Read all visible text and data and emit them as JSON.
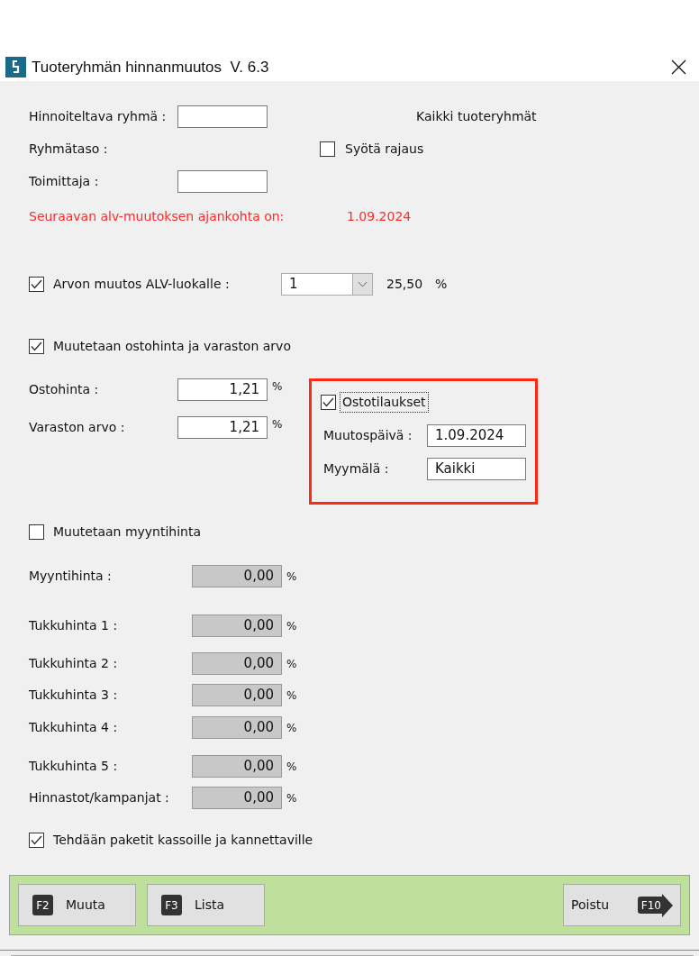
{
  "window": {
    "title": "Tuoteryhmän hinnanmuutos  V. 6.3"
  },
  "group_field": {
    "label": "Hinnoiteltava ryhmä :"
  },
  "group_summary": "Kaikki tuoteryhmät",
  "group_level": {
    "label": "Ryhmätaso :"
  },
  "limit_checkbox": {
    "label": "Syötä rajaus",
    "checked": false
  },
  "supplier_field": {
    "label": "Toimittaja :"
  },
  "vat_notice": {
    "text": "Seuraavan alv-muutoksen ajankohta on:",
    "date": "1.09.2024"
  },
  "vat_change": {
    "label": "Arvon muutos ALV-luokalle :",
    "checked": true,
    "class_value": "1",
    "rate": "25,50",
    "unit": "%"
  },
  "purchase": {
    "label": "Muutetaan ostohinta ja varaston arvo",
    "checked": true,
    "rows": [
      {
        "label": "Ostohinta :",
        "value": "1,21",
        "unit": "%",
        "disabled": false
      },
      {
        "label": "Varaston arvo :",
        "value": "1,21",
        "unit": "%",
        "disabled": false
      }
    ]
  },
  "orders": {
    "label": "Ostotilaukset",
    "checked": true,
    "focused": true,
    "fields": [
      {
        "label": "Muutospäivä :",
        "value": "1.09.2024"
      },
      {
        "label": "Myymälä :",
        "value": "Kaikki"
      }
    ]
  },
  "sales": {
    "label": "Muutetaan myyntihinta",
    "checked": false,
    "rows": [
      {
        "label": "Myyntihinta :",
        "value": "0,00",
        "unit": "%",
        "disabled": true
      },
      {
        "label": "Tukkuhinta 1 :",
        "value": "0,00",
        "unit": "%",
        "disabled": true
      },
      {
        "label": "Tukkuhinta 2 :",
        "value": "0,00",
        "unit": "%",
        "disabled": true
      },
      {
        "label": "Tukkuhinta 3 :",
        "value": "0,00",
        "unit": "%",
        "disabled": true
      },
      {
        "label": "Tukkuhinta 4 :",
        "value": "0,00",
        "unit": "%",
        "disabled": true
      },
      {
        "label": "Tukkuhinta 5 :",
        "value": "0,00",
        "unit": "%",
        "disabled": true
      },
      {
        "label": "Hinnastot/kampanjat :",
        "value": "0,00",
        "unit": "%",
        "disabled": true
      }
    ]
  },
  "packages": {
    "label": "Tehdään paketit kassoille ja kannettaville",
    "checked": true
  },
  "buttons": [
    {
      "kind": "key",
      "key": "F2",
      "label": "Muuta"
    },
    {
      "kind": "key",
      "key": "F3",
      "label": "Lista"
    },
    {
      "kind": "exit",
      "key": "F10",
      "label": "Poistu"
    }
  ]
}
